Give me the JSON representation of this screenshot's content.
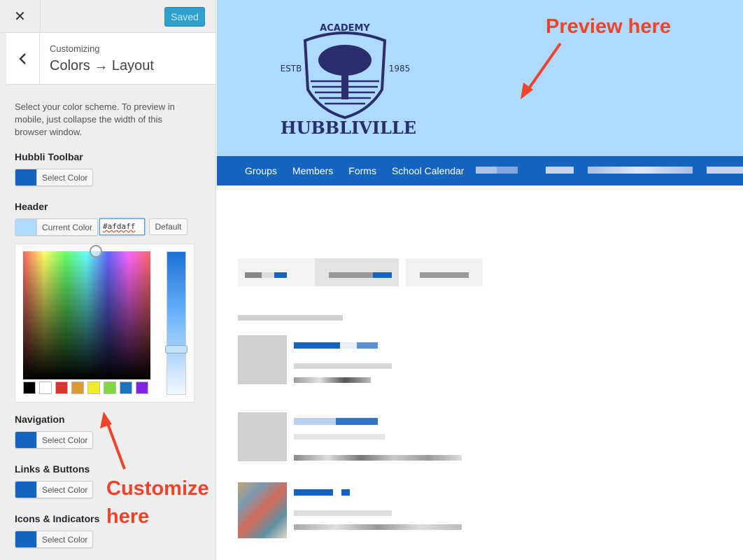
{
  "sidebar": {
    "close_label": "✕",
    "saved_label": "Saved",
    "crumb_small": "Customizing",
    "crumb_title": "Colors → Layout",
    "description": "Select your color scheme. To preview in mobile, just collapse the width of this browser window.",
    "controls": [
      {
        "label": "Hubbli Toolbar",
        "button": "Select Color",
        "color": "#1565c0"
      },
      {
        "label": "Header",
        "button": "Current Color",
        "color": "#afdaff"
      },
      {
        "label": "Navigation",
        "button": "Select Color",
        "color": "#1565c0"
      },
      {
        "label": "Links & Buttons",
        "button": "Select Color",
        "color": "#1565c0"
      },
      {
        "label": "Icons & Indicators",
        "button": "Select Color",
        "color": "#1565c0"
      }
    ],
    "header_hex_value": "#afdaff",
    "default_label": "Default",
    "palette": [
      "#000000",
      "#ffffff",
      "#dd3333",
      "#dd9933",
      "#eeee22",
      "#81d742",
      "#1e73be",
      "#8224e3"
    ]
  },
  "preview": {
    "header_color": "#afdaff",
    "logo": {
      "top": "ACADEMY",
      "left": "ESTB",
      "right": "1985",
      "name": "HUBBLIVILLE"
    },
    "nav_color": "#1565c0",
    "nav_items": [
      "Groups",
      "Members",
      "Forms",
      "School Calendar"
    ]
  },
  "annotations": {
    "preview": "Preview here",
    "customize_line1": "Customize",
    "customize_line2": "here",
    "color": "#f0442a"
  }
}
